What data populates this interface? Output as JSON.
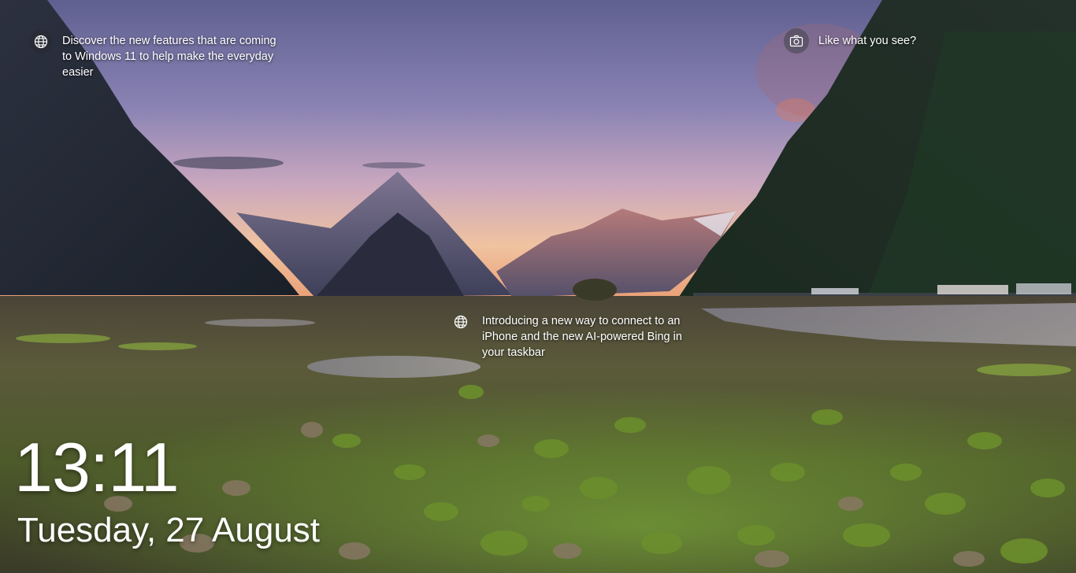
{
  "lockscreen": {
    "background_scene": "mountain-fjord-sunset-mossy-rocks",
    "colors": {
      "sky_top": "#6b6a9a",
      "sky_horizon": "#e8b49a",
      "mountain_dark": "#1c2430",
      "moss_green": "#7fb03a",
      "text": "#ffffff"
    },
    "hotspots": [
      {
        "icon": "globe-icon",
        "text": "Discover the new features that are coming to Windows 11 to help make the everyday easier"
      },
      {
        "icon": "globe-icon",
        "text": "Introducing a new way to connect to an iPhone and the new AI-powered Bing in your taskbar"
      },
      {
        "icon": "camera-icon",
        "text": "Like what you see?"
      }
    ],
    "time": "13:11",
    "date": "Tuesday, 27 August"
  }
}
